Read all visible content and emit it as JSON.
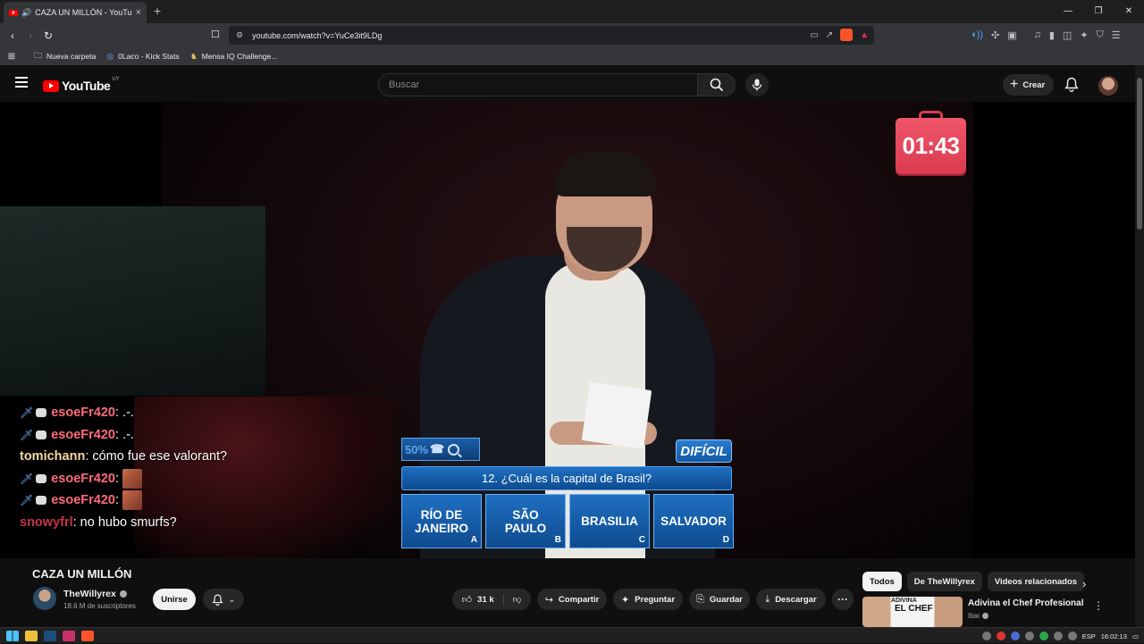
{
  "browser": {
    "tab_title": "CAZA UN MILLÓN - YouTube",
    "tab_close": "×",
    "new_tab": "+",
    "url": "youtube.com/watch?v=YuCe3it9LDg",
    "bookmarks": [
      {
        "label": "Nueva carpeta",
        "icon": "folder-icon"
      },
      {
        "label": "0Laco - Kick Stats",
        "icon": "kick-icon"
      },
      {
        "label": "Mensa IQ Challenge...",
        "icon": "mensa-icon"
      }
    ]
  },
  "youtube": {
    "logo_text": "YouTube",
    "country_code": "UY",
    "search_placeholder": "Buscar",
    "create_label": "Crear"
  },
  "player": {
    "timer": "01:43",
    "quiz": {
      "lifeline_50": "50%",
      "difficulty": "DIFÍCIL",
      "question": "12. ¿Cuál es la capital de Brasil?",
      "answers": [
        {
          "text": "RÍO DE JANEIRO",
          "letter": "A"
        },
        {
          "text": "SÃO PAULO",
          "letter": "B"
        },
        {
          "text": "BRASILIA",
          "letter": "C"
        },
        {
          "text": "SALVADOR",
          "letter": "D"
        }
      ]
    },
    "chat": [
      {
        "user": "esoeFr420",
        "msg": ": .-.",
        "color": "#ff6b7a",
        "badges": true,
        "emote": false
      },
      {
        "user": "esoeFr420",
        "msg": ": .-.",
        "color": "#ff6b7a",
        "badges": true,
        "emote": false
      },
      {
        "user": "tomichann",
        "msg": ": cómo fue ese valorant?",
        "color": "#f5d9a0",
        "badges": false,
        "emote": false
      },
      {
        "user": "esoeFr420",
        "msg": ":",
        "color": "#ff6b7a",
        "badges": true,
        "emote": true
      },
      {
        "user": "esoeFr420",
        "msg": ":",
        "color": "#ff6b7a",
        "badges": true,
        "emote": true
      },
      {
        "user": "snowyfrl",
        "msg": ": no hubo smurfs?",
        "color": "#c23448",
        "badges": false,
        "emote": false
      }
    ]
  },
  "video": {
    "title": "CAZA UN MILLÓN",
    "channel": "TheWillyrex",
    "subscribers": "18.6 M de suscriptores",
    "join_label": "Unirse",
    "likes": "31 k",
    "share_label": "Compartir",
    "ask_label": "Preguntar",
    "save_label": "Guardar",
    "download_label": "Descargar",
    "more_label": "···"
  },
  "sidebar": {
    "chips": [
      "Todos",
      "De TheWillyrex",
      "Videos relacionados"
    ],
    "recommendation": {
      "title": "Adivina el Chef Profesional",
      "channel": "Ibai",
      "thumb_line1": "ADIVINA",
      "thumb_line2": "EL CHEF"
    }
  },
  "taskbar": {
    "lang": "ESP",
    "time": "16:02:13"
  }
}
